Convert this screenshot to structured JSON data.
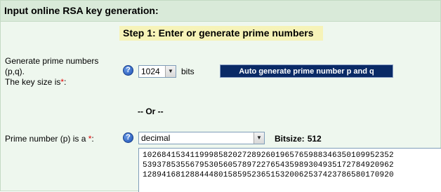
{
  "header": {
    "title": "Input online RSA key generation:"
  },
  "step": {
    "title": "Step 1: Enter or generate prime numbers"
  },
  "generate": {
    "label_line1": "Generate prime numbers",
    "label_line2": "(p,q).",
    "label_line3": "The key size is",
    "required_mark": "*",
    "label_colon": ":",
    "help_icon": "?",
    "key_size_value": "1024",
    "key_size_unit": "bits",
    "auto_button_label": "Auto generate prime number p and q"
  },
  "separator": {
    "text": "-- Or --"
  },
  "prime_p": {
    "label": "Prime number (p) is a ",
    "required_mark": "*",
    "label_colon": ":",
    "help_icon": "?",
    "format_value": "decimal",
    "bitsize_label": "Bitsize:",
    "bitsize_value": "512",
    "value_line1": "10268415341199985820272892601965765988346350109952352",
    "value_line2": "53937853556795305605789722765435989304935172784920962",
    "value_line3": "12894168128844480158595236515320062537423786580170920"
  },
  "icons": {
    "help": "help-question-icon",
    "dropdown": "chevron-down-icon"
  },
  "colors": {
    "panel_bg": "#eef7ee",
    "header_bg": "#d9ead9",
    "step_bg": "#f6f3b8",
    "button_bg": "#0a2a66",
    "required": "#e00000"
  }
}
